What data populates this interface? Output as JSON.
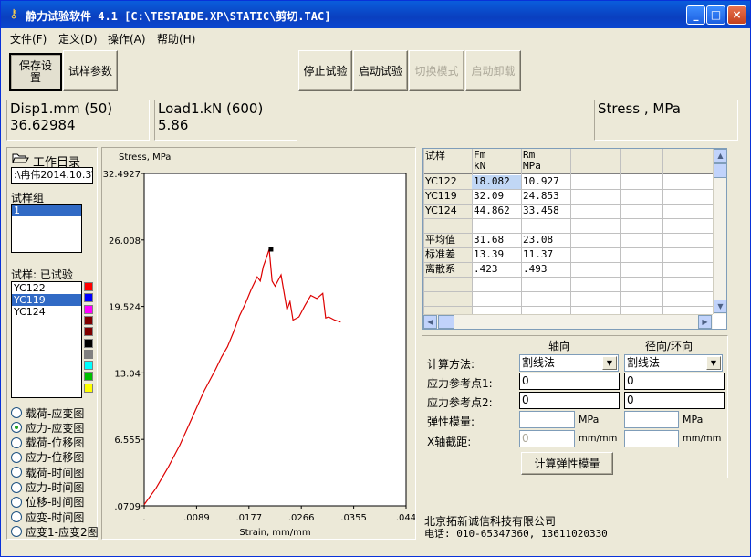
{
  "window": {
    "title": "静力试验软件 4.1 [C:\\TESTAIDE.XP\\STATIC\\剪切.TAC]",
    "min_label": "_",
    "max_label": "□",
    "close_label": "×"
  },
  "menu": [
    "文件(F)",
    "定义(D)",
    "操作(A)",
    "帮助(H)"
  ],
  "toolbar": {
    "save_settings": "保存设\n置",
    "sample_params": "试样参数",
    "stop_test": "停止试验",
    "start_test": "启动试验",
    "switch_mode": "切换模式",
    "start_unload": "启动卸载"
  },
  "readouts": {
    "disp_label": "Disp1.mm (50)",
    "disp_value": "36.62984",
    "load_label": "Load1.kN (600)",
    "load_value": "5.86",
    "stress_label": "Stress , MPa"
  },
  "left_panel": {
    "workdir_label": "工作目录",
    "workdir_value": ":\\冉伟2014.10.3\\",
    "sample_group_label": "试样组",
    "sample_groups": [
      "1"
    ],
    "samples_label": "试样: 已试验",
    "samples": [
      "YC122",
      "YC119",
      "YC124"
    ],
    "selected_sample": "YC119",
    "swatch_colors": [
      "#ff0000",
      "#0000ff",
      "#ff00ff",
      "#800000",
      "#800000",
      "#000000",
      "#808080",
      "#00ffff",
      "#00c000",
      "#ffff00"
    ],
    "plot_modes": [
      "载荷-应变图",
      "应力-应变图",
      "载荷-位移图",
      "应力-位移图",
      "载荷-时间图",
      "应力-时间图",
      "位移-时间图",
      "应变-时间图",
      "应变1-应变2图"
    ],
    "selected_mode": "应力-应变图"
  },
  "chart_data": {
    "type": "line",
    "title": "",
    "ylabel": "Stress, MPa",
    "xlabel": "Strain, mm/mm",
    "xlim": [
      0,
      0.044
    ],
    "ylim": [
      0.0709,
      32.4927
    ],
    "x_ticks": [
      ".",
      ".0089",
      ".0177",
      ".0266",
      ".0355",
      ".044"
    ],
    "y_ticks": [
      "32.4927",
      "26.008",
      "19.524",
      "13.04",
      "6.555",
      ".0709"
    ],
    "series": [
      {
        "color": "#dd0000",
        "x": [
          0,
          0.002,
          0.004,
          0.006,
          0.008,
          0.01,
          0.012,
          0.013,
          0.014,
          0.015,
          0.016,
          0.017,
          0.018,
          0.019,
          0.0195,
          0.02,
          0.0205,
          0.021,
          0.0215,
          0.022,
          0.023,
          0.024,
          0.0245,
          0.025,
          0.026,
          0.027,
          0.028,
          0.029,
          0.03,
          0.0305,
          0.031,
          0.032,
          0.033
        ],
        "y": [
          0.2,
          1.8,
          3.8,
          6.0,
          8.6,
          11.2,
          13.4,
          14.6,
          15.6,
          17.0,
          18.6,
          19.8,
          21.2,
          22.4,
          22.0,
          23.4,
          24.2,
          25.1,
          22.0,
          21.5,
          22.6,
          19.2,
          20.0,
          18.2,
          18.5,
          19.6,
          20.6,
          20.3,
          20.8,
          18.4,
          18.5,
          18.2,
          18.0
        ]
      }
    ],
    "peak_marker": {
      "x": 0.0213,
      "y": 25.1
    }
  },
  "results": {
    "header": {
      "name": "试样",
      "fm": "Fm\nkN",
      "rm": "Rm\nMPa"
    },
    "rows": [
      {
        "name": "YC122",
        "fm": "18.082",
        "rm": "10.927"
      },
      {
        "name": "YC119",
        "fm": "32.09",
        "rm": "24.853"
      },
      {
        "name": "YC124",
        "fm": "44.862",
        "rm": "33.458"
      }
    ],
    "stats": [
      {
        "name": "平均值",
        "fm": "31.68",
        "rm": "23.08"
      },
      {
        "name": "标准差",
        "fm": "13.39",
        "rm": "11.37"
      },
      {
        "name": "离散系",
        "fm": ".423",
        "rm": ".493"
      }
    ]
  },
  "calc": {
    "axial_header": "轴向",
    "radial_header": "径向/环向",
    "method_label": "计算方法:",
    "method_axial": "割线法",
    "method_radial": "割线法",
    "ref1_label": "应力参考点1:",
    "ref1_axial": "0",
    "ref1_radial": "0",
    "ref2_label": "应力参考点2:",
    "ref2_axial": "0",
    "ref2_radial": "0",
    "modulus_label": "弹性模量:",
    "modulus_axial": "",
    "modulus_radial": "",
    "modulus_unit": "MPa",
    "intercept_label": "X轴截距:",
    "intercept_axial": "0",
    "intercept_radial": "",
    "intercept_unit": "mm/mm",
    "calc_button": "计算弹性模量"
  },
  "footer": {
    "company": "北京拓新诚信科技有限公司",
    "phone": "电话: 010-65347360, 13611020330"
  }
}
